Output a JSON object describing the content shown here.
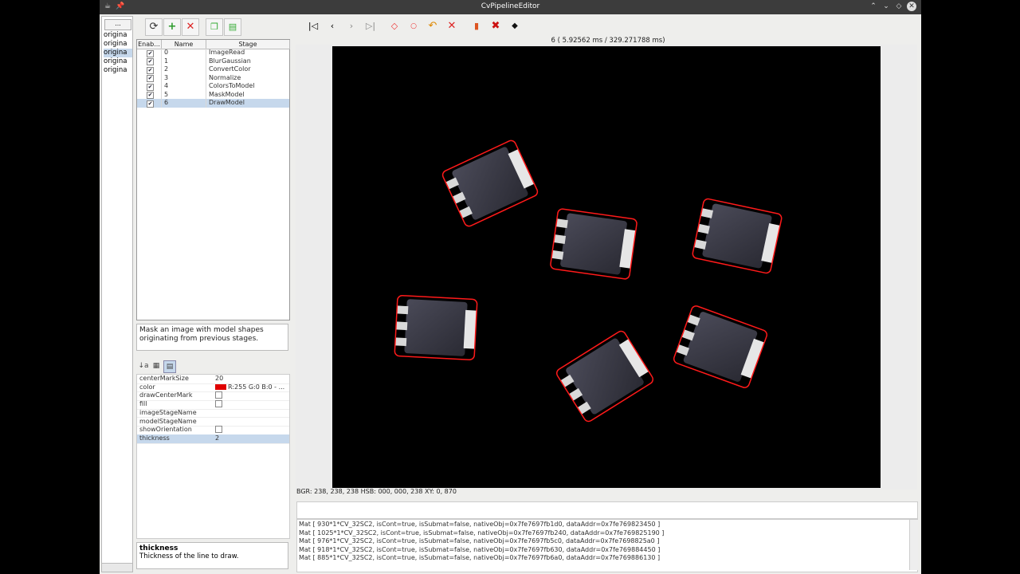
{
  "window": {
    "title": "CvPipelineEditor"
  },
  "strip": {
    "button": "...",
    "items": [
      "origina",
      "origina",
      "origina",
      "origina",
      "origina"
    ]
  },
  "toolbar_left": {
    "icons": [
      "refresh-icon",
      "add-icon",
      "delete-icon",
      "copy-icon",
      "paste-icon"
    ]
  },
  "stages": {
    "headers": {
      "enabled": "Enab...",
      "name": "Name",
      "stage": "Stage"
    },
    "rows": [
      {
        "name": "0",
        "stage": "ImageRead"
      },
      {
        "name": "1",
        "stage": "BlurGaussian"
      },
      {
        "name": "2",
        "stage": "ConvertColor"
      },
      {
        "name": "3",
        "stage": "Normalize"
      },
      {
        "name": "4",
        "stage": "ColorsToModel"
      },
      {
        "name": "5",
        "stage": "MaskModel"
      },
      {
        "name": "6",
        "stage": "DrawModel"
      }
    ],
    "selected": 6
  },
  "description": "Mask an image with model shapes originating from previous stages.",
  "properties": [
    {
      "key": "centerMarkSize",
      "value": "20"
    },
    {
      "key": "color",
      "value": "R:255 G:0 B:0 - ..."
    },
    {
      "key": "drawCenterMark",
      "value": ""
    },
    {
      "key": "fill",
      "value": ""
    },
    {
      "key": "imageStageName",
      "value": ""
    },
    {
      "key": "modelStageName",
      "value": ""
    },
    {
      "key": "showOrientation",
      "value": ""
    },
    {
      "key": "thickness",
      "value": "2"
    }
  ],
  "help": {
    "title": "thickness",
    "text": "Thickness of the line to draw."
  },
  "status": "6 ( 5.92562 ms / 329.271788 ms)",
  "pixel_info": "BGR: 238, 238, 238 HSB: 000, 000, 238 XY: 0, 870",
  "log": [
    "Mat [ 930*1*CV_32SC2, isCont=true, isSubmat=false, nativeObj=0x7fe7697fb1d0, dataAddr=0x7fe769823450 ]",
    "Mat [ 1025*1*CV_32SC2, isCont=true, isSubmat=false, nativeObj=0x7fe7697fb240, dataAddr=0x7fe769825190 ]",
    "Mat [ 976*1*CV_32SC2, isCont=true, isSubmat=false, nativeObj=0x7fe7697fb5c0, dataAddr=0x7fe7698825a0 ]",
    "Mat [ 918*1*CV_32SC2, isCont=true, isSubmat=false, nativeObj=0x7fe7697fb630, dataAddr=0x7fe769884450 ]",
    "Mat [ 885*1*CV_32SC2, isCont=true, isSubmat=false, nativeObj=0x7fe7697fb6a0, dataAddr=0x7fe769886130 ]"
  ],
  "colors": {
    "outline": "#ff1a1a",
    "selection": "#c6d8ec"
  }
}
